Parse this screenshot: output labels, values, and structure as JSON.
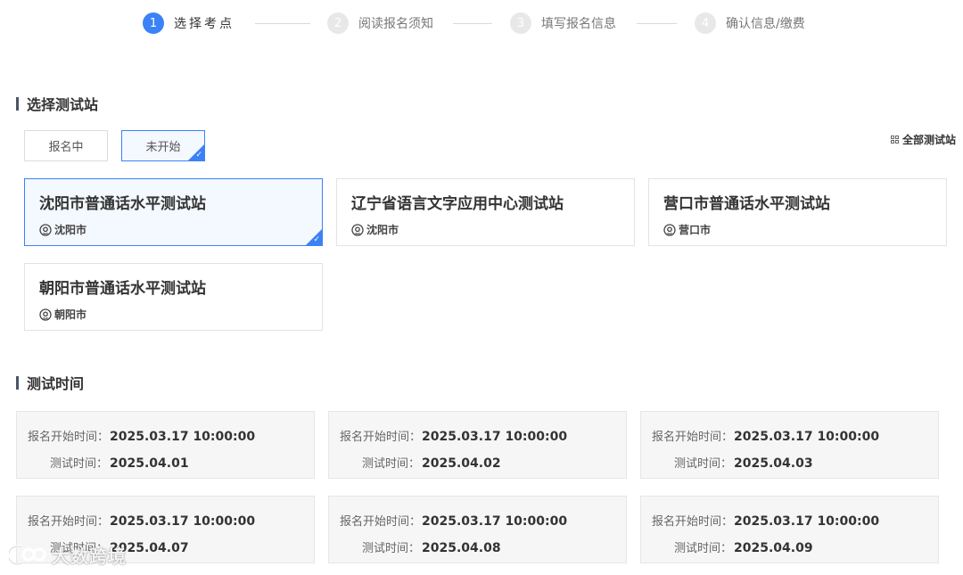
{
  "stepper": {
    "steps": [
      {
        "num": "1",
        "label": "选择考点"
      },
      {
        "num": "2",
        "label": "阅读报名须知"
      },
      {
        "num": "3",
        "label": "填写报名信息"
      },
      {
        "num": "4",
        "label": "确认信息/缴费"
      }
    ],
    "active_index": 0,
    "accent_color": "#3b82f6"
  },
  "station_section": {
    "title": "选择测试站",
    "filters": [
      "报名中",
      "未开始"
    ],
    "selected_filter": "未开始",
    "all_stations_label": "全部测试站",
    "stations": [
      {
        "name": "沈阳市普通话水平测试站",
        "city": "沈阳市",
        "selected": true
      },
      {
        "name": "辽宁省语言文字应用中心测试站",
        "city": "沈阳市",
        "selected": false
      },
      {
        "name": "营口市普通话水平测试站",
        "city": "营口市",
        "selected": false
      },
      {
        "name": "朝阳市普通话水平测试站",
        "city": "朝阳市",
        "selected": false
      }
    ]
  },
  "time_section": {
    "title": "测试时间",
    "reg_start_label": "报名开始时间：",
    "test_time_label": "测试时间：",
    "sessions": [
      {
        "reg_start": "2025.03.17 10:00:00",
        "test_date": "2025.04.01"
      },
      {
        "reg_start": "2025.03.17 10:00:00",
        "test_date": "2025.04.02"
      },
      {
        "reg_start": "2025.03.17 10:00:00",
        "test_date": "2025.04.03"
      },
      {
        "reg_start": "2025.03.17 10:00:00",
        "test_date": "2025.04.07"
      },
      {
        "reg_start": "2025.03.17 10:00:00",
        "test_date": "2025.04.08"
      },
      {
        "reg_start": "2025.03.17 10:00:00",
        "test_date": "2025.04.09"
      }
    ]
  },
  "watermark": {
    "text": "大数跨境"
  }
}
